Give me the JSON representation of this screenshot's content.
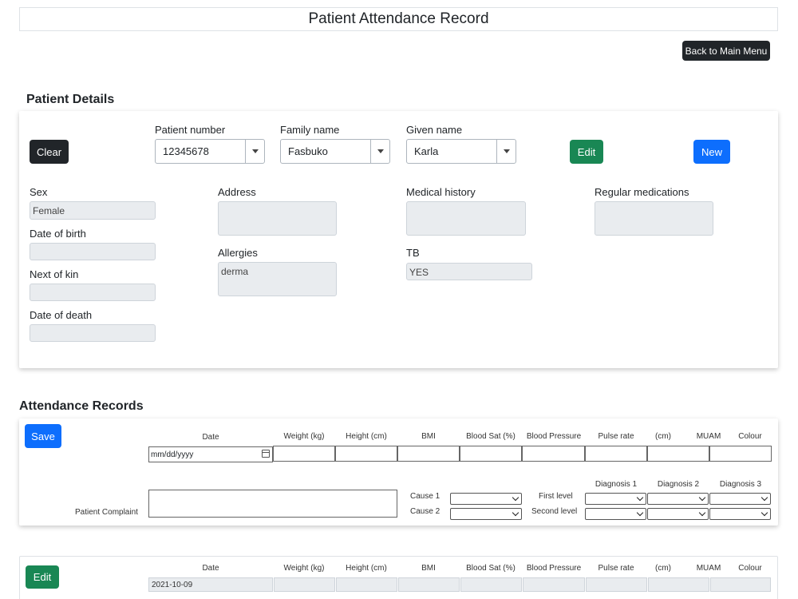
{
  "page": {
    "title": "Patient Attendance Record"
  },
  "nav": {
    "back_label": "Back to Main Menu"
  },
  "patient_details": {
    "heading": "Patient Details",
    "clear_label": "Clear",
    "edit_label": "Edit",
    "new_label": "New",
    "patient_number": {
      "label": "Patient number",
      "value": "12345678"
    },
    "family_name": {
      "label": "Family name",
      "value": "Fasbuko"
    },
    "given_name": {
      "label": "Given name",
      "value": "Karla"
    },
    "sex": {
      "label": "Sex",
      "value": "Female"
    },
    "dob": {
      "label": "Date of birth",
      "value": ""
    },
    "next_of_kin": {
      "label": "Next of kin",
      "value": ""
    },
    "date_of_death": {
      "label": "Date of death",
      "value": ""
    },
    "address": {
      "label": "Address",
      "value": ""
    },
    "allergies": {
      "label": "Allergies",
      "value": "derma"
    },
    "medical_history": {
      "label": "Medical history",
      "value": ""
    },
    "tb": {
      "label": "TB",
      "value": "YES"
    },
    "regular_medications": {
      "label": "Regular medications",
      "value": ""
    }
  },
  "attendance": {
    "heading": "Attendance Records",
    "save_label": "Save",
    "edit_label": "Edit",
    "columns": [
      "Date",
      "Weight (kg)",
      "Height (cm)",
      "BMI",
      "Blood Sat (%)",
      "Blood Pressure",
      "Pulse rate",
      "(cm)",
      "MUAM",
      "Colour"
    ],
    "date_placeholder": "mm/dd/yyyy",
    "complaint_label": "Patient Complaint",
    "cause1_label": "Cause 1",
    "cause2_label": "Cause 2",
    "first_level_label": "First level",
    "second_level_label": "Second level",
    "diagnosis_headers": [
      "Diagnosis 1",
      "Diagnosis 2",
      "Diagnosis 3"
    ],
    "record_date": "2021-10-09"
  },
  "icons": {
    "calendar": "calendar-icon",
    "dropdown": "chevron-down-icon"
  }
}
